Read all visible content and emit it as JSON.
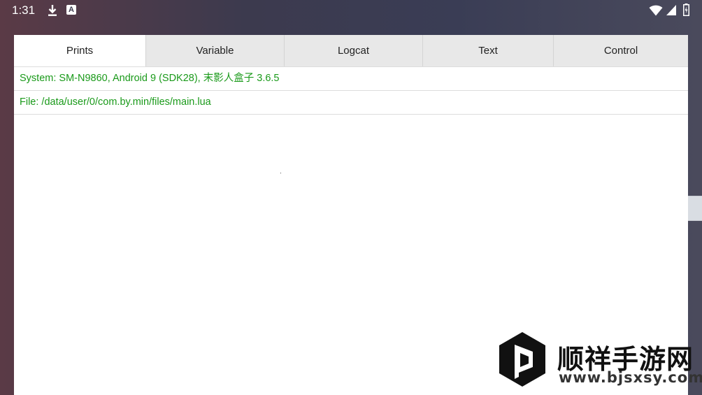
{
  "status_bar": {
    "time": "1:31",
    "notification_letter": "A",
    "icons": [
      "download-icon",
      "a-notification-icon",
      "wifi-icon",
      "signal-icon",
      "battery-icon"
    ]
  },
  "tabs": [
    {
      "label": "Prints",
      "active": true
    },
    {
      "label": "Variable",
      "active": false
    },
    {
      "label": "Logcat",
      "active": false
    },
    {
      "label": "Text",
      "active": false
    },
    {
      "label": "Control",
      "active": false
    }
  ],
  "prints": [
    "System: SM-N9860, Android 9 (SDK28), 末影人盒子 3.6.5",
    "File: /data/user/0/com.by.min/files/main.lua"
  ],
  "watermark": {
    "title": "顺祥手游网",
    "url": "www.bjsxsy.com"
  },
  "colors": {
    "print_text": "#1a9a1a",
    "active_tab_bg": "#ffffff",
    "inactive_tab_bg": "#e8e8e8"
  }
}
